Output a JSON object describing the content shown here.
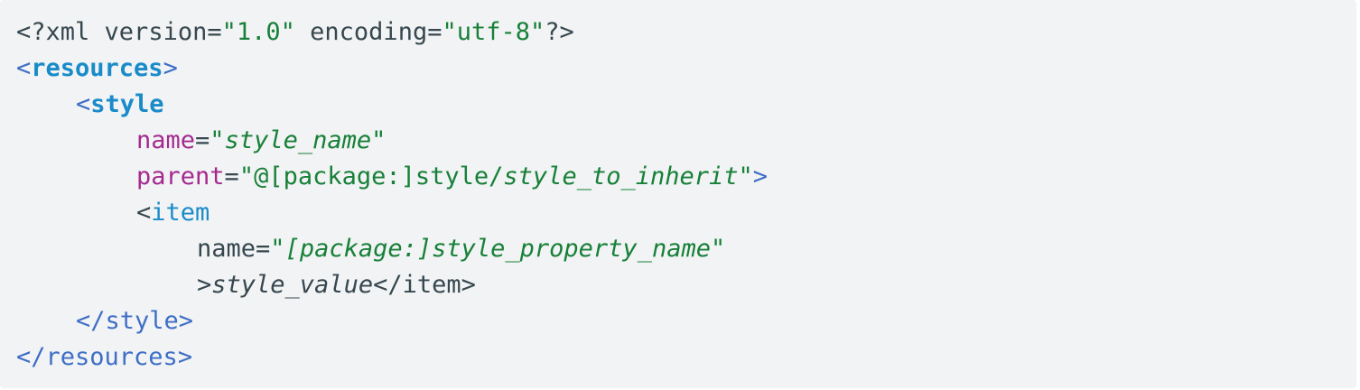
{
  "code": {
    "l1": {
      "open": "<?xml ",
      "attr1": "version",
      "eq1": "=",
      "val1": "\"1.0\"",
      "sp": " ",
      "attr2": "encoding",
      "eq2": "=",
      "val2": "\"utf-8\"",
      "close": "?>"
    },
    "l2": {
      "lt": "<",
      "tag": "resources",
      "gt": ">"
    },
    "l3": {
      "lt": "<",
      "tag": "style"
    },
    "l4": {
      "attr": "name",
      "eq": "=",
      "q1": "\"",
      "val": "style_name",
      "q2": "\""
    },
    "l5": {
      "attr": "parent",
      "eq": "=",
      "q1": "\"",
      "val_plain": "@[package:]style/",
      "val_italic": "style_to_inherit",
      "q2": "\"",
      "gt": ">"
    },
    "l6": {
      "lt": "<",
      "tag": "item"
    },
    "l7": {
      "attr": "name",
      "eq": "=",
      "q1": "\"",
      "val": "[package:]style_property_name",
      "q2": "\""
    },
    "l8": {
      "gt": ">",
      "value": "style_value",
      "close": "</item>"
    },
    "l9": {
      "lt": "</",
      "tag": "style",
      "gt": ">"
    },
    "l10": {
      "lt": "</",
      "tag": "resources",
      "gt": ">"
    }
  }
}
